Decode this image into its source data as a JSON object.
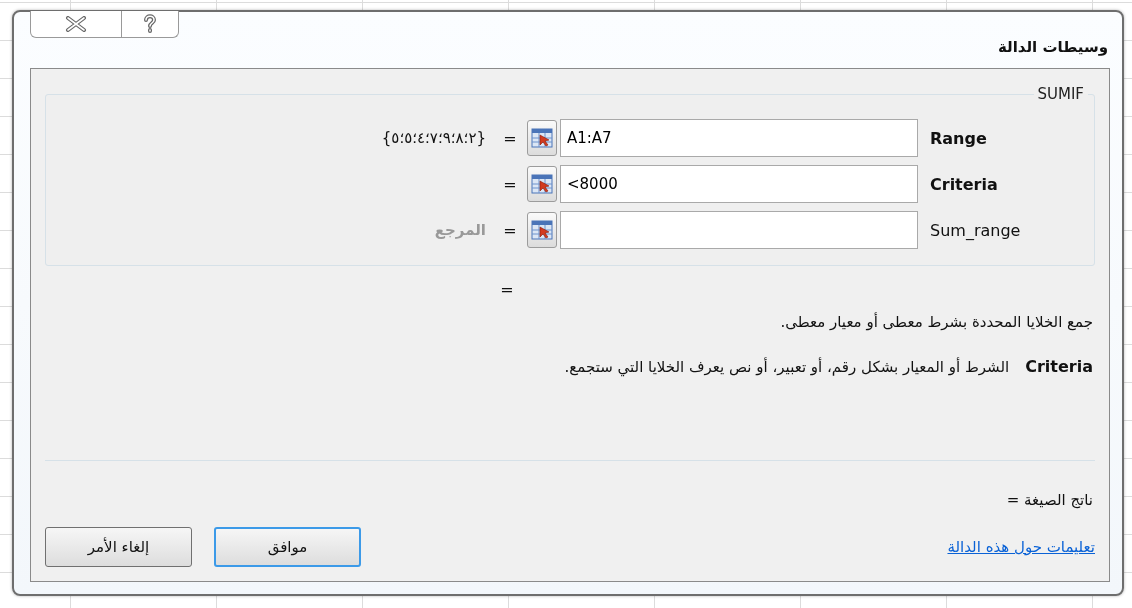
{
  "window": {
    "title": "وسيطات الدالة"
  },
  "function": {
    "name": "SUMIF",
    "arguments": [
      {
        "name": "Range",
        "required": true,
        "input": "A1:A7",
        "result": "{٢؛٨؛٩؛٧؛٤؛٥؛٥}"
      },
      {
        "name": "Criteria",
        "required": true,
        "input": "<8000"
      },
      {
        "name": "Sum_range",
        "required": false,
        "result": "المرجع",
        "result_dimmed": true
      }
    ],
    "equals_sign": "=",
    "result_equals": "=",
    "description": "جمع الخلايا المحددة بشرط معطى أو معيار معطى.",
    "argument_help": {
      "name": "Criteria",
      "text": "الشرط أو المعيار بشكل رقم، أو تعبير، أو نص يعرف الخلايا التي ستجمع."
    }
  },
  "formula_result": "ناتج الصيغة =",
  "help_link": "تعليمات حول هذه الدالة",
  "buttons": [
    {
      "label": "موافق",
      "default": true
    },
    {
      "label": "إلغاء الأمر",
      "default": false
    }
  ]
}
